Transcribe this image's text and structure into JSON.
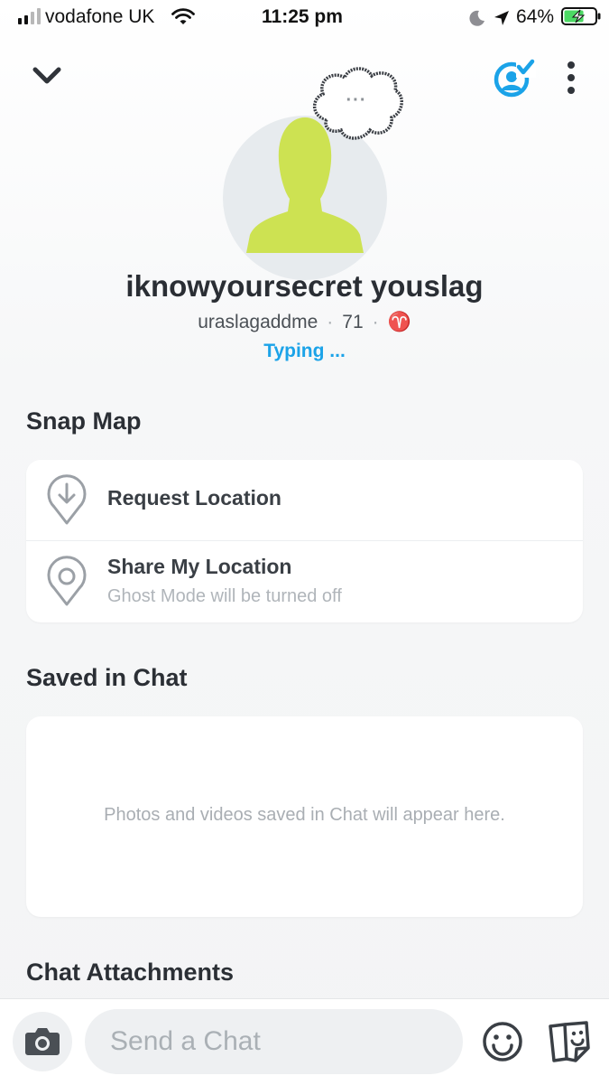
{
  "status_bar": {
    "carrier": "vodafone UK",
    "time": "11:25 pm",
    "battery": "64%",
    "battery_level": 0.64,
    "icons": [
      "signal-icon",
      "wifi-icon",
      "moon-icon",
      "location-arrow-icon",
      "battery-charging-icon"
    ]
  },
  "header": {
    "icons": [
      "chevron-down-icon",
      "bitmoji-check-icon",
      "more-vertical-icon"
    ]
  },
  "profile": {
    "bubble_text": "···",
    "display_name": "iknowyoursecret youslag",
    "username": "uraslagaddme",
    "dot": "·",
    "snap_score": "71",
    "zodiac": "♈",
    "status": "Typing ..."
  },
  "snap_map": {
    "title": "Snap Map",
    "items": [
      {
        "label": "Request Location",
        "icon": "request-location-icon"
      },
      {
        "label": "Share My Location",
        "sublabel": "Ghost Mode will be turned off",
        "icon": "location-pin-icon"
      }
    ]
  },
  "saved_in_chat": {
    "title": "Saved in Chat",
    "empty_text": "Photos and videos saved in Chat will appear here."
  },
  "chat_attachments": {
    "title": "Chat Attachments"
  },
  "chat_bar": {
    "placeholder": "Send a Chat",
    "icons": [
      "camera-icon",
      "smiley-icon",
      "stickers-icon"
    ]
  },
  "colors": {
    "accent": "#1ba3e8",
    "avatar_green": "#cde252",
    "text_dark": "#2b2f35",
    "text_muted": "#b0b5ba",
    "battery_green": "#4cd964"
  }
}
